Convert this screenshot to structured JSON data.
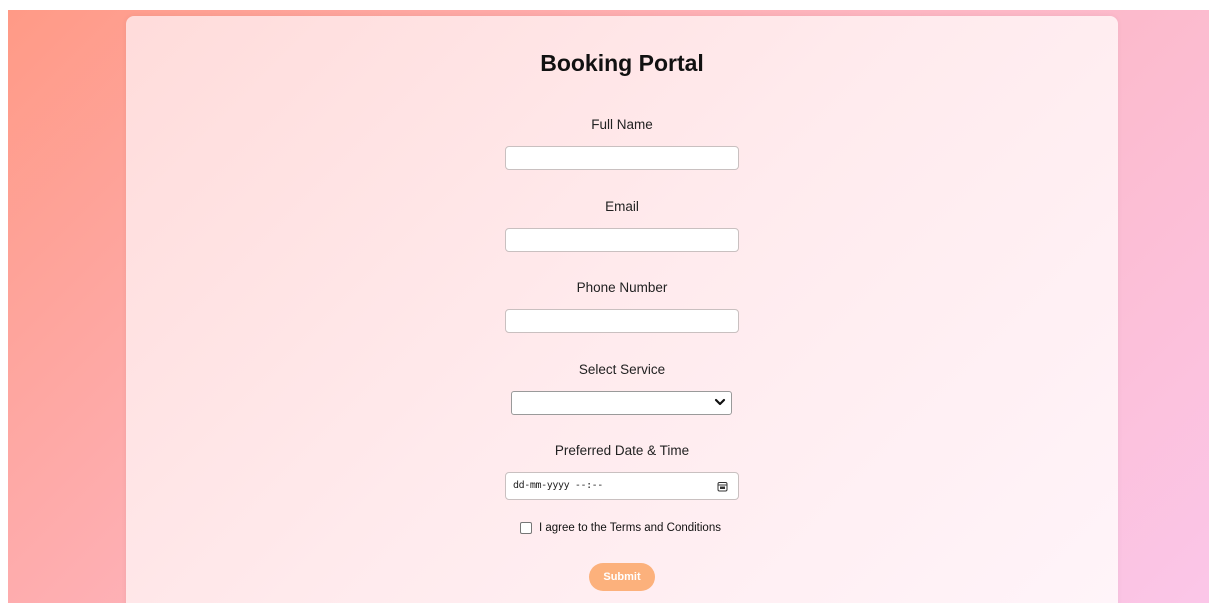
{
  "page": {
    "title": "Booking Portal"
  },
  "form": {
    "full_name": {
      "label": "Full Name",
      "value": "",
      "placeholder": ""
    },
    "email": {
      "label": "Email",
      "value": "",
      "placeholder": ""
    },
    "phone": {
      "label": "Phone Number",
      "value": "",
      "placeholder": ""
    },
    "service": {
      "label": "Select Service",
      "selected": ""
    },
    "datetime": {
      "label": "Preferred Date & Time",
      "placeholder": "dd-mm-yyyy --:--"
    },
    "terms": {
      "label": "I agree to the Terms and Conditions",
      "checked": false
    },
    "submit_label": "Submit"
  },
  "icons": {
    "select_caret": "chevron-down-icon",
    "datetime_picker": "calendar-icon"
  },
  "colors": {
    "submit_button": "#fcb17c",
    "background_start": "#ff9a86",
    "background_end": "#fbc6e8"
  }
}
